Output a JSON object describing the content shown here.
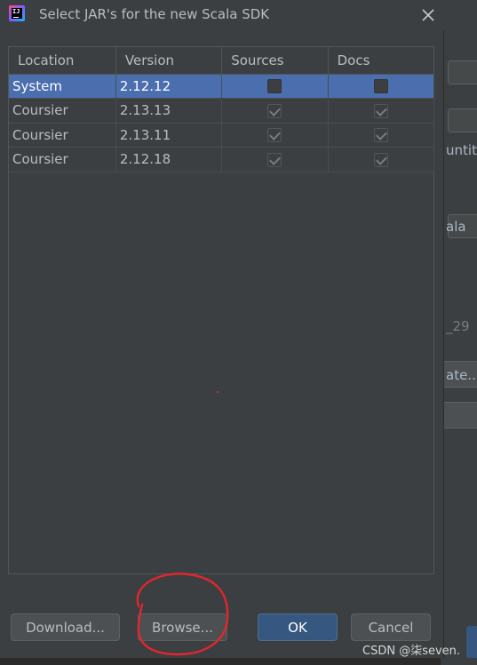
{
  "dialog": {
    "title": "Select JAR's for the new Scala SDK",
    "app_icon": "intellij-idea-icon"
  },
  "table": {
    "columns": [
      "Location",
      "Version",
      "Sources",
      "Docs"
    ],
    "rows": [
      {
        "location": "System",
        "version": "2.12.12",
        "sources": false,
        "docs": false,
        "selected": true
      },
      {
        "location": "Coursier",
        "version": "2.13.13",
        "sources": true,
        "docs": true,
        "selected": false
      },
      {
        "location": "Coursier",
        "version": "2.13.11",
        "sources": true,
        "docs": true,
        "selected": false
      },
      {
        "location": "Coursier",
        "version": "2.12.18",
        "sources": true,
        "docs": true,
        "selected": false
      }
    ]
  },
  "buttons": {
    "download": "Download...",
    "browse": "Browse...",
    "ok": "OK",
    "cancel": "Cancel"
  },
  "background": {
    "text_untitled": "untitle",
    "text_scala": "ala",
    "text_version": "_29",
    "text_update": "ate..."
  },
  "watermark": "CSDN @柒seven.",
  "colors": {
    "selection": "#4b6eaf",
    "primary_button": "#365880",
    "annotation": "#e0262e"
  }
}
